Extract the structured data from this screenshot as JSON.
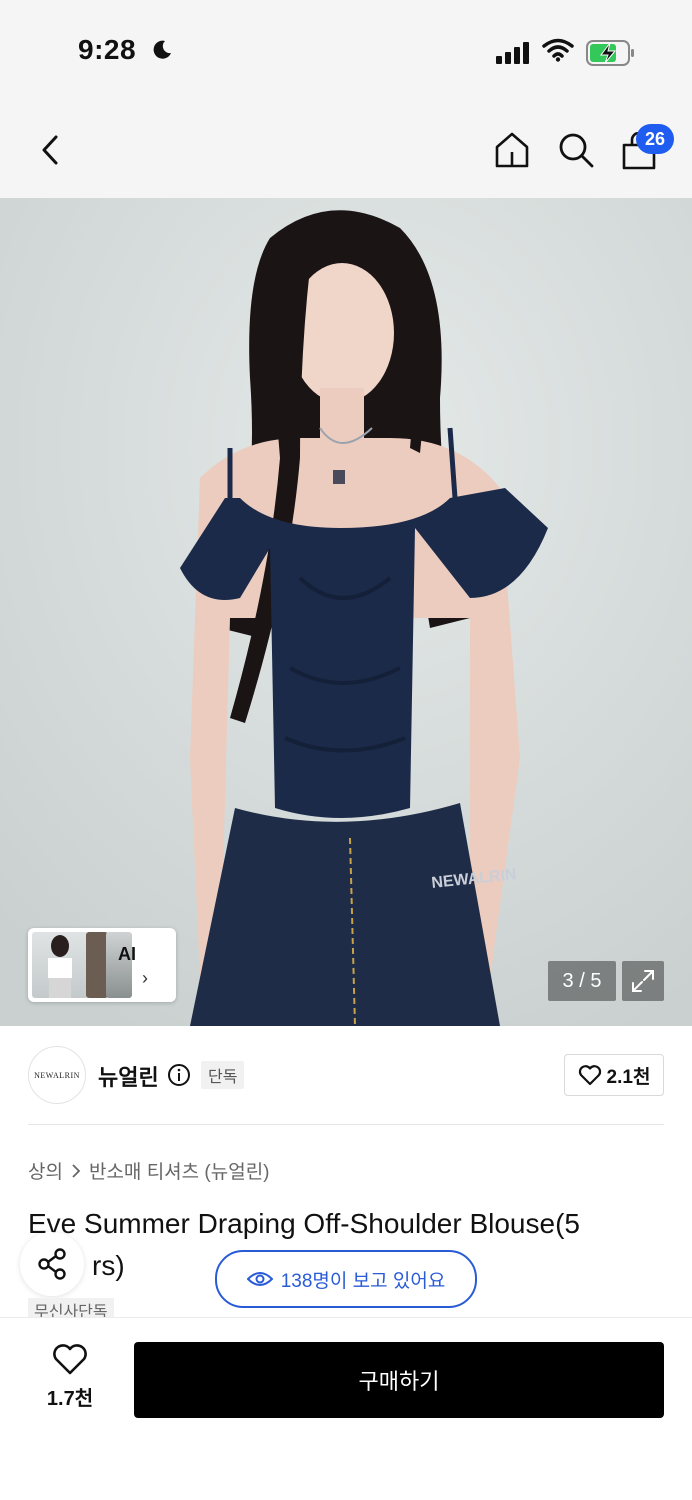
{
  "status_bar": {
    "time": "9:28",
    "icons": [
      "moon-icon",
      "cellular-signal-icon",
      "wifi-icon",
      "battery-charging-icon"
    ]
  },
  "nav": {
    "icons": [
      "back-arrow-icon",
      "home-icon",
      "search-icon",
      "cart-icon"
    ],
    "cart_badge": "26"
  },
  "gallery": {
    "counter": "3 / 5",
    "ai_label": "AI",
    "ai_chevron": "›",
    "background_color": "#d8dede",
    "top_color": "#1c2a4a",
    "jeans_color": "#1f2c47",
    "jeans_print": "NEWALRIN"
  },
  "brand": {
    "logo_text": "NEWALRIN",
    "name": "뉴얼린",
    "tag": "단독",
    "likes": "2.1천"
  },
  "product": {
    "breadcrumb": [
      "상의",
      "반소매 티셔츠 (뉴얼린)"
    ],
    "title": "Eve Summer Draping Off-Shoulder Blouse(5 colors)",
    "title_visible_prefix": "Eve Summer Draping Off-Shoulder Blouse(5",
    "title_visible_suffix": "rs)",
    "viewers": "138명이 보고 있어요",
    "exclusive_tag": "무신사단독"
  },
  "bottom_bar": {
    "wish_count": "1.7천",
    "buy_label": "구매하기"
  },
  "colors": {
    "accent_blue": "#2a5bd7",
    "badge_blue": "#1f5cf0",
    "buy_button": "#000000"
  }
}
